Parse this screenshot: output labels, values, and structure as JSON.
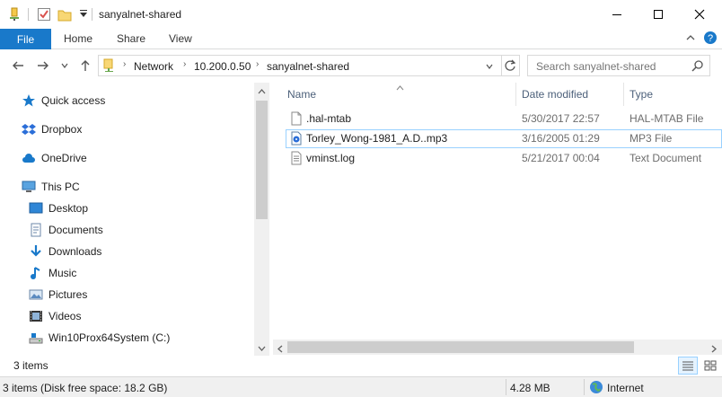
{
  "window": {
    "title": "sanyalnet-shared",
    "minimize_icon": "minimize-icon",
    "maximize_icon": "maximize-icon",
    "close_icon": "close-icon"
  },
  "ribbon": {
    "tabs": [
      {
        "label": "File",
        "active": true
      },
      {
        "label": "Home"
      },
      {
        "label": "Share"
      },
      {
        "label": "View"
      }
    ],
    "accent_color": "#1979ca"
  },
  "address": {
    "crumbs": [
      "Network",
      "10.200.0.50",
      "sanyalnet-shared"
    ],
    "search_placeholder": "Search sanyalnet-shared"
  },
  "nav": {
    "items": [
      {
        "label": "Quick access",
        "icon": "star-icon"
      },
      {
        "label": "Dropbox",
        "icon": "dropbox-icon"
      },
      {
        "label": "OneDrive",
        "icon": "cloud-icon"
      },
      {
        "label": "This PC",
        "icon": "computer-icon"
      },
      {
        "label": "Desktop",
        "icon": "desktop-icon"
      },
      {
        "label": "Documents",
        "icon": "documents-icon"
      },
      {
        "label": "Downloads",
        "icon": "download-icon"
      },
      {
        "label": "Music",
        "icon": "music-icon"
      },
      {
        "label": "Pictures",
        "icon": "pictures-icon"
      },
      {
        "label": "Videos",
        "icon": "videos-icon"
      },
      {
        "label": "Win10Prox64System (C:)",
        "icon": "drive-icon"
      }
    ]
  },
  "files": {
    "columns": [
      "Name",
      "Date modified",
      "Type"
    ],
    "rows": [
      {
        "name": ".hal-mtab",
        "date": "5/30/2017 22:57",
        "type": "HAL-MTAB File",
        "icon": "file-icon"
      },
      {
        "name": "Torley_Wong-1981_A.D..mp3",
        "date": "3/16/2005 01:29",
        "type": "MP3 File",
        "icon": "audio-file-icon",
        "selected": true
      },
      {
        "name": "vminst.log",
        "date": "5/21/2017 00:04",
        "type": "Text Document",
        "icon": "text-file-icon"
      }
    ]
  },
  "status": {
    "item_count": "3 items",
    "details": "3 items (Disk free space: 18.2 GB)",
    "size": "4.28 MB",
    "zone": "Internet"
  }
}
